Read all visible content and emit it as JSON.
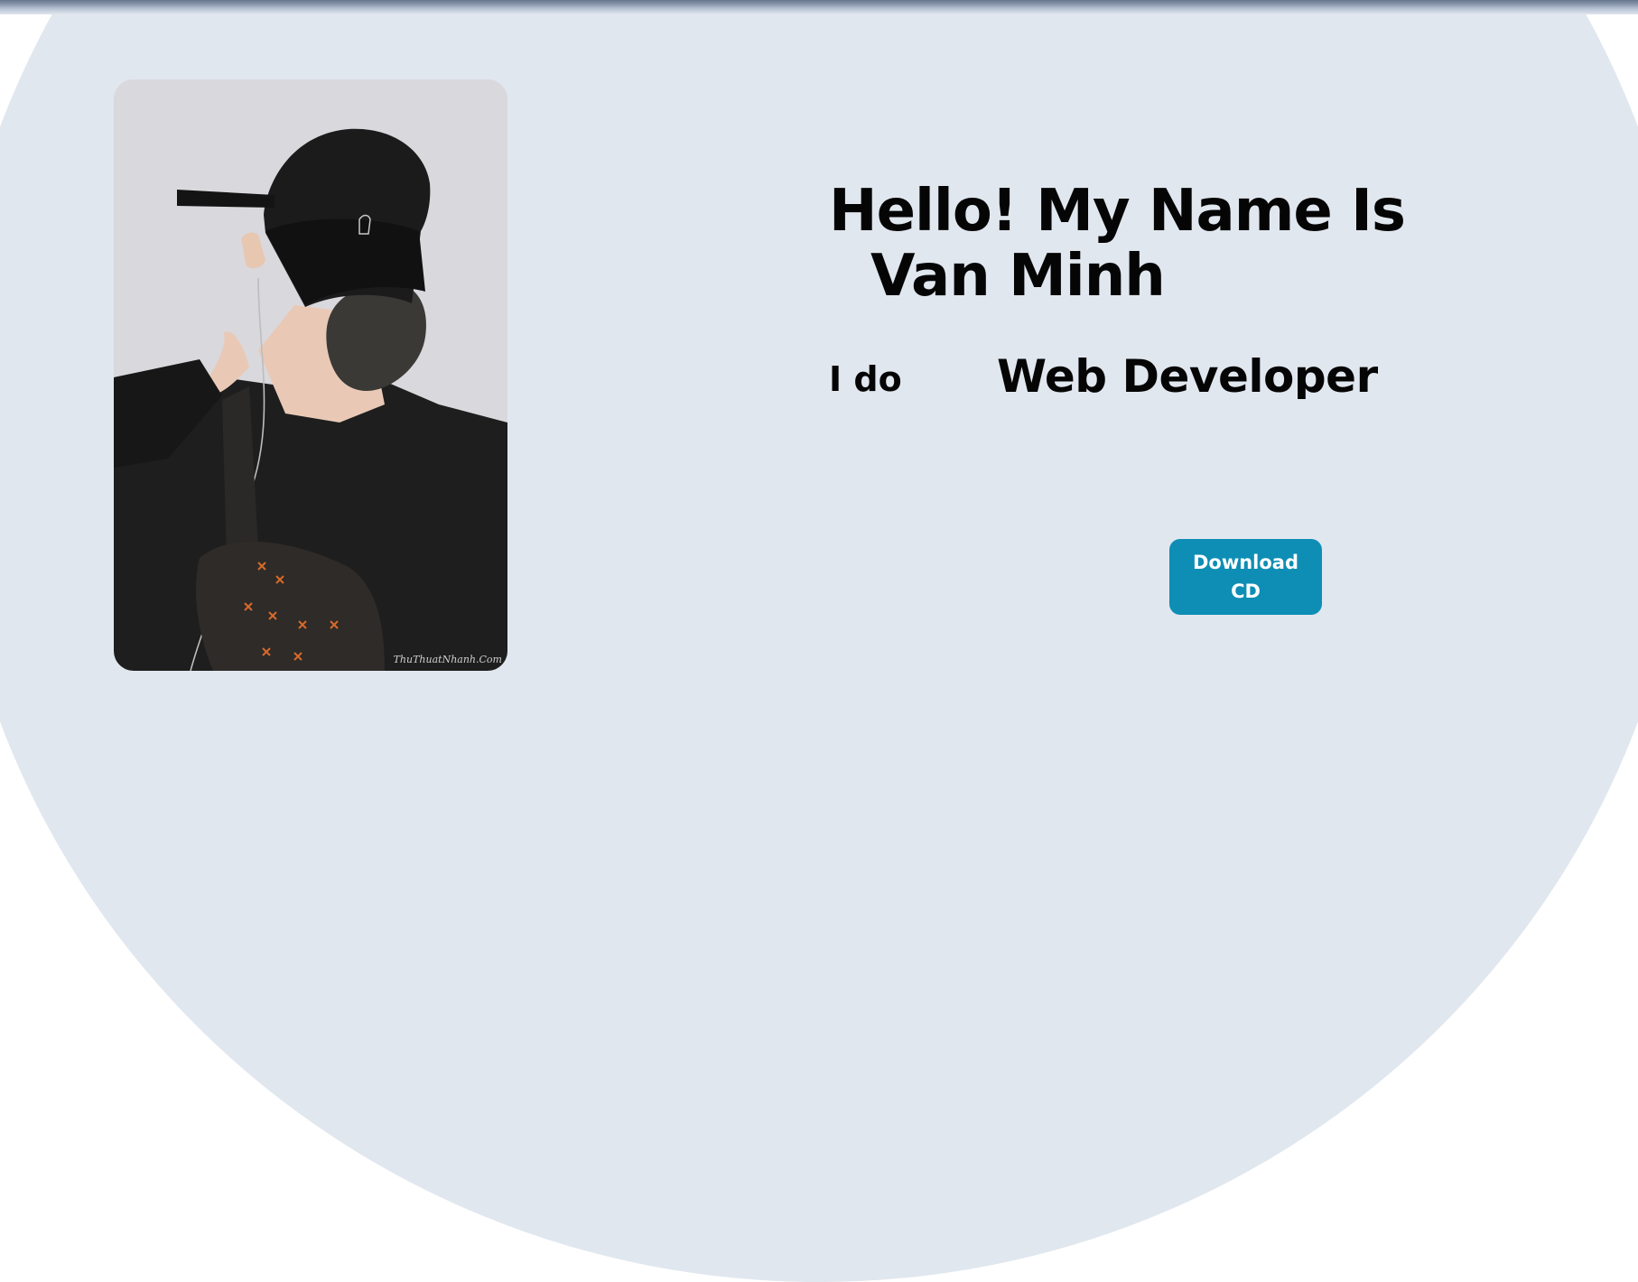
{
  "header": {
    "bar_color": "#7f8da2"
  },
  "hero": {
    "background_color": "#e1e7ef",
    "portrait": {
      "description_icon": "portrait-illustration",
      "watermark": "ThuThuatNhanh.Com"
    },
    "greeting": "Hello! My Name Is",
    "name": "Van Minh",
    "i_do_label": "I do",
    "role": "Web Developer",
    "download_button_label": "Download CD",
    "button_color": "#0e8eb5"
  }
}
